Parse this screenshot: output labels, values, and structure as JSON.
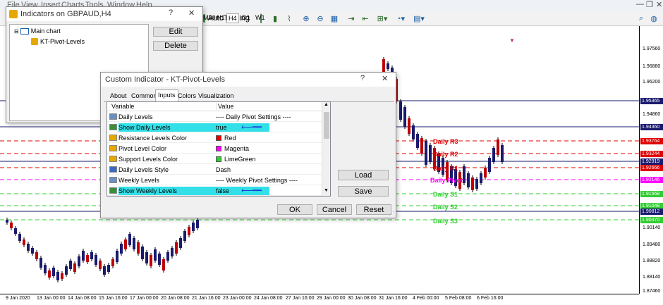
{
  "menu": [
    "File",
    "View",
    "Insert",
    "Charts",
    "Tools",
    "Window",
    "Help"
  ],
  "toolbar": {
    "autotrading_label": "AutoTrading",
    "timeframes": [
      "M30",
      "H1",
      "H4",
      "D1",
      "W1"
    ],
    "active_timeframe": "H4"
  },
  "indicators_window": {
    "title": "Indicators on GBPAUD,H4",
    "tree_root": "Main chart",
    "tree_child": "KT-Pivot-Levels",
    "edit_label": "Edit",
    "delete_label": "Delete"
  },
  "custom_indicator": {
    "title": "Custom Indicator - KT-Pivot-Levels",
    "tabs": [
      "About",
      "Common",
      "Inputs",
      "Colors",
      "Visualization"
    ],
    "active_tab": "Inputs",
    "col_variable": "Variable",
    "col_value": "Value",
    "rows": [
      {
        "variable": "Daily Levels",
        "value": "---- Daily Pivot Settings ----",
        "icon": "abc",
        "highlight": false
      },
      {
        "variable": "Show Daily Levels",
        "value": "true",
        "icon": "toggle",
        "highlight": true
      },
      {
        "variable": "Resistance Levels Color",
        "value": "Red",
        "icon": "color",
        "swatch": "#e00000",
        "highlight": false
      },
      {
        "variable": "Pivot Level Color",
        "value": "Magenta",
        "icon": "color",
        "swatch": "#ff00ff",
        "highlight": false
      },
      {
        "variable": "Support Levels Color",
        "value": "LimeGreen",
        "icon": "color",
        "swatch": "#32cd32",
        "highlight": false
      },
      {
        "variable": "Daily Levels Style",
        "value": "Dash",
        "icon": "style",
        "highlight": false
      },
      {
        "variable": "Weekly Levels",
        "value": "---- Weekly Pivot Settings ----",
        "icon": "abc",
        "highlight": false
      },
      {
        "variable": "Show Weekly Levels",
        "value": "false",
        "icon": "toggle",
        "highlight": true
      }
    ],
    "load_label": "Load",
    "save_label": "Save",
    "ok_label": "OK",
    "cancel_label": "Cancel",
    "reset_label": "Reset"
  },
  "chart": {
    "price_labels": [
      "1.97560",
      "1.96880",
      "1.96200",
      "1.95365",
      "1.94860",
      "1.94360",
      "1.93764",
      "1.93244",
      "1.92919",
      "1.92666",
      "1.92146",
      "1.91568",
      "1.91048",
      "1.90812",
      "1.90470",
      "1.90140",
      "1.89480",
      "1.88820",
      "1.88140",
      "1.87460"
    ],
    "price_tags": [
      {
        "text": "1.95365",
        "bg": "#1a1a6e"
      },
      {
        "text": "1.94360",
        "bg": "#1a1a6e"
      },
      {
        "text": "1.93764",
        "bg": "#e00000"
      },
      {
        "text": "1.93244",
        "bg": "#e00000"
      },
      {
        "text": "1.92919",
        "bg": "#1a1a6e"
      },
      {
        "text": "1.92666",
        "bg": "#e00000"
      },
      {
        "text": "1.92146",
        "bg": "#ff00ff"
      },
      {
        "text": "1.91568",
        "bg": "#32cd32"
      },
      {
        "text": "1.91048",
        "bg": "#32cd32"
      },
      {
        "text": "1.90812",
        "bg": "#1a1a6e"
      },
      {
        "text": "1.90470",
        "bg": "#32cd32"
      }
    ],
    "time_labels": [
      "9 Jan 2020",
      "13 Jan 00:00",
      "14 Jan 08:00",
      "15 Jan 16:00",
      "17 Jan 00:00",
      "20 Jan 08:00",
      "21 Jan 16:00",
      "23 Jan 00:00",
      "24 Jan 08:00",
      "27 Jan 16:00",
      "29 Jan 00:00",
      "30 Jan 08:00",
      "31 Jan 16:00",
      "4 Feb 00:00",
      "5 Feb 08:00",
      "6 Feb 16:00"
    ],
    "level_labels": [
      {
        "text": "Daily R3",
        "color": "#e00000"
      },
      {
        "text": "Daily R2",
        "color": "#e00000"
      },
      {
        "text": "Daily R1",
        "color": "#e00000"
      },
      {
        "text": "Daily Pivot",
        "color": "#ff00ff"
      },
      {
        "text": "Daily S1",
        "color": "#32cd32"
      },
      {
        "text": "Daily S2",
        "color": "#32cd32"
      },
      {
        "text": "Daily S3",
        "color": "#32cd32"
      }
    ]
  }
}
